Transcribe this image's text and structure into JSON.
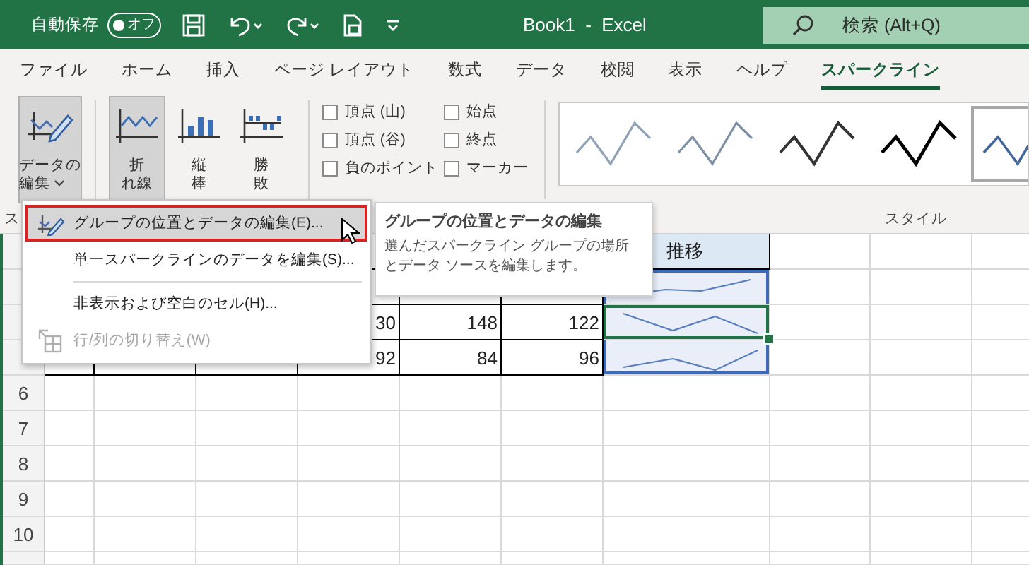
{
  "title_bar": {
    "autosave_label": "自動保存",
    "autosave_toggle": {
      "label": "オフ",
      "on": false
    },
    "title": "Book1  -  Excel",
    "search": {
      "placeholder": "検索 (Alt+Q)"
    }
  },
  "tabs": [
    {
      "label": "ファイル",
      "selected": false
    },
    {
      "label": "ホーム",
      "selected": false
    },
    {
      "label": "挿入",
      "selected": false
    },
    {
      "label": "ページ レイアウト",
      "selected": false
    },
    {
      "label": "数式",
      "selected": false
    },
    {
      "label": "データ",
      "selected": false
    },
    {
      "label": "校閲",
      "selected": false
    },
    {
      "label": "表示",
      "selected": false
    },
    {
      "label": "ヘルプ",
      "selected": false
    },
    {
      "label": "スパークライン",
      "selected": true
    }
  ],
  "ribbon": {
    "edit_data": {
      "label_lines": [
        "データの",
        "編集"
      ],
      "pressed": true
    },
    "types": [
      {
        "kind": "line",
        "label_lines": [
          "折",
          "れ線"
        ],
        "selected": true
      },
      {
        "kind": "column",
        "label_lines": [
          "縦",
          "棒"
        ],
        "selected": false
      },
      {
        "kind": "winloss",
        "label_lines": [
          "勝",
          "敗"
        ],
        "selected": false
      }
    ],
    "show_options": [
      {
        "label": "頂点 (山)",
        "checked": false
      },
      {
        "label": "頂点 (谷)",
        "checked": false
      },
      {
        "label": "負のポイント",
        "checked": false
      },
      {
        "label": "始点",
        "checked": false
      },
      {
        "label": "終点",
        "checked": false
      },
      {
        "label": "マーカー",
        "checked": false
      }
    ],
    "styles": [
      {
        "color": "#8fa2b6",
        "selected": false
      },
      {
        "color": "#7d90a6",
        "selected": false
      },
      {
        "color": "#333333",
        "selected": false
      },
      {
        "color": "#000000",
        "selected": false
      },
      {
        "color": "#44679e",
        "selected": true
      }
    ],
    "group_labels": [
      "ス",
      "スタイル"
    ]
  },
  "sheet": {
    "row_numbers": [
      "6",
      "7",
      "8",
      "9",
      "10"
    ],
    "table": {
      "header": "推移",
      "data_rows": [
        {
          "values": [
            "30",
            "148",
            "122"
          ]
        },
        {
          "values": [
            "92",
            "84",
            "96"
          ]
        }
      ],
      "sparklines": [
        {
          "active": false
        },
        {
          "active": true
        },
        {
          "active": false
        }
      ]
    }
  },
  "menu": {
    "items": [
      {
        "label": "グループの位置とデータの編集(E)...",
        "kind": "edit",
        "hovered": true,
        "disabled": false
      },
      {
        "label": "単一スパークラインのデータを編集(S)...",
        "kind": "plain",
        "hovered": false,
        "disabled": false
      },
      {
        "label": "非表示および空白のセル(H)...",
        "kind": "plain",
        "hovered": false,
        "disabled": false,
        "separator_before": true
      },
      {
        "label": "行/列の切り替え(W)",
        "kind": "switch",
        "hovered": false,
        "disabled": true
      }
    ]
  },
  "tooltip": {
    "title": "グループの位置とデータの編集",
    "description_lines": [
      "選んだスパークライン グループの場所",
      "とデータ ソースを編集します。"
    ]
  }
}
